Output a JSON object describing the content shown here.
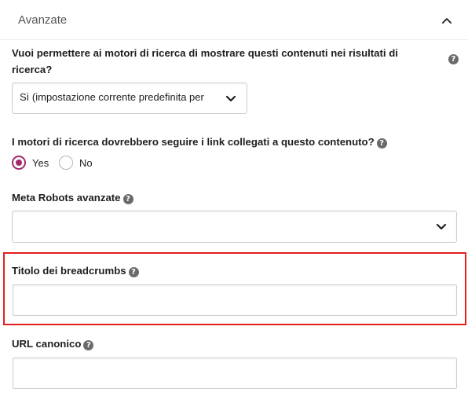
{
  "panel": {
    "title": "Avanzate"
  },
  "search_results_question": {
    "label_line1": "Vuoi permettere ai motori di ricerca di mostrare questi contenuti nei risultati di",
    "label_line2": "ricerca?",
    "help_glyph": "?",
    "selected_value": "Sì (impostazione corrente predefinita per"
  },
  "follow_links_question": {
    "label": "I motori di ricerca dovrebbero seguire i link collegati a questo contenuto?",
    "help_glyph": "?",
    "options": [
      {
        "label": "Yes",
        "checked": true
      },
      {
        "label": "No",
        "checked": false
      }
    ],
    "accent_color": "#a4286a"
  },
  "meta_robots": {
    "label": "Meta Robots avanzate",
    "help_glyph": "?",
    "selected_value": ""
  },
  "breadcrumbs_title": {
    "label": "Titolo dei breadcrumbs",
    "help_glyph": "?",
    "value": "",
    "highlight_color": "#e41e1e"
  },
  "canonical_url": {
    "label": "URL canonico",
    "help_glyph": "?",
    "value": ""
  },
  "icons": {
    "collapse": "chevron-up-icon",
    "dropdown": "chevron-down-icon",
    "help": "question-circle-icon"
  }
}
